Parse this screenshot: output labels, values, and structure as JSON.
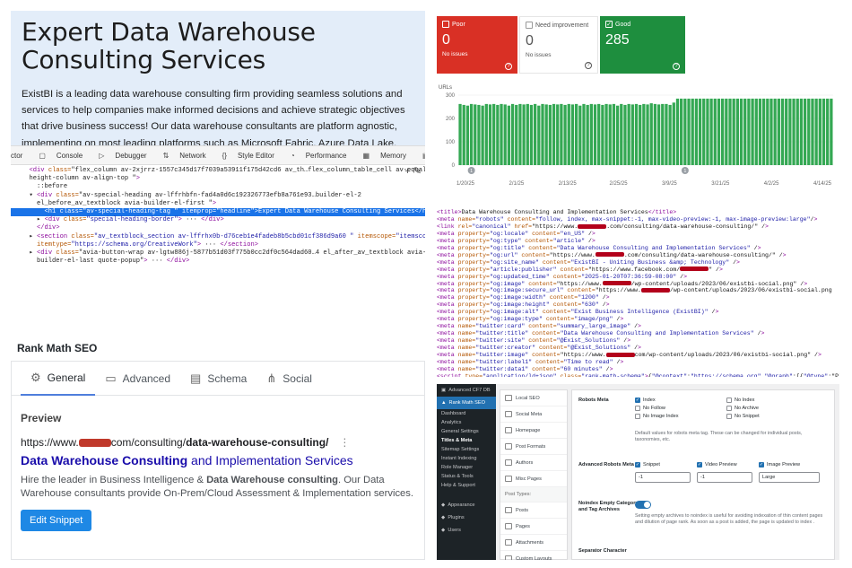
{
  "website": {
    "heading": "Expert Data Warehouse Consulting Services",
    "paragraph": "ExistBI is a leading data warehouse consulting firm providing seamless solutions and services to help companies make informed decisions and achieve strategic objectives that drive business success! Our data warehouse consultants are platform agnostic, implementing on most leading platforms such as Microsoft Fabric, Azure Data Lake, Azure SQL Data Warehouse, Azure Synapse,"
  },
  "devtools": {
    "tabs": [
      "ctor",
      "Console",
      "Debugger",
      "Network",
      "Style Editor",
      "Performance",
      "Memory",
      "Storage",
      "Accessi"
    ],
    "code_lines": [
      {
        "text": "  <div class=\"flex_column av-2xjrrz-1557c345d17f7039a53911f175d42cd6 av_th…flex_column_table_cell av-equal-",
        "sel": false
      },
      {
        "text": "  height-column av-align-top \">",
        "sel": false
      },
      {
        "text": "    ::before",
        "sel": false
      },
      {
        "text": "  ▾ <div class=\"av-special-heading av-lffrhbfn-fad4a0d6c192326773efb8a761e93…builder-el-2",
        "sel": false
      },
      {
        "text": "    el_before_av_textblock avia-builder-el-first \">",
        "sel": false
      },
      {
        "text": "      <h1 class=\"av-special-heading-tag \" itemprop=\"headline\">Expert Data Warehouse Consulting Services</h1>",
        "sel": true
      },
      {
        "text": "    ▸ <div class=\"special-heading-border\"> ··· </div>",
        "sel": false
      },
      {
        "text": "    </div>",
        "sel": false
      },
      {
        "text": "  ▸ <section class=\"av_textblock_section av-lffrhx0b-d76ceb1e4fadeb8b5cbd01cf386d9a60 \" itemscope=\"itemscope\"",
        "sel": false
      },
      {
        "text": "    itemtype=\"https://schema.org/CreativeWork\"> ··· </section>",
        "sel": false
      },
      {
        "text": "  ▸ <div class=\"avia-button-wrap av-lgtw886j-5877b51d03f775b0cc2df0c564dad60…4 el_after_av_textblock avia-",
        "sel": false
      },
      {
        "text": "    builder-el-last quote-popup\"> ··· </div>",
        "sel": false
      }
    ]
  },
  "rankmath": {
    "title": "Rank Math SEO",
    "tabs": [
      "General",
      "Advanced",
      "Schema",
      "Social"
    ],
    "preview_label": "Preview",
    "url_prefix": "https://www.",
    "url_path": "com/consulting/",
    "url_slug": "data-warehouse-consulting/",
    "serp_title_bold": "Data Warehouse Consulting",
    "serp_title_rest": " and Implementation Services",
    "serp_desc_1": "Hire the leader in Business Intelligence & ",
    "serp_desc_bold": "Data Warehouse consulting",
    "serp_desc_2": ". Our Data Warehouse consultants provide On-Prem/Cloud Assessment & Implementation services.",
    "edit_button": "Edit Snippet"
  },
  "console": {
    "cards": [
      {
        "label": "Poor",
        "value": "0",
        "sub": "No issues"
      },
      {
        "label": "Need improvement",
        "value": "0",
        "sub": "No issues"
      },
      {
        "label": "Good",
        "value": "285",
        "sub": ""
      }
    ],
    "urls_label": "URLs",
    "colors": {
      "poor": "#d93025",
      "good": "#1e8e3e",
      "bar": "#34a853"
    }
  },
  "chart_data": {
    "type": "bar",
    "ylabel": "URLs",
    "ylim": [
      0,
      300
    ],
    "yticks": [
      0,
      100,
      200,
      300
    ],
    "xticks": [
      "1/20/25",
      "2/1/25",
      "2/13/25",
      "2/25/25",
      "3/9/25",
      "3/21/25",
      "4/2/25",
      "4/14/25"
    ],
    "annotations": [
      {
        "index": 3,
        "label": "1"
      },
      {
        "index": 60,
        "label": "1"
      }
    ],
    "values": [
      262,
      258,
      255,
      262,
      260,
      258,
      255,
      262,
      260,
      262,
      258,
      262,
      260,
      255,
      262,
      258,
      262,
      260,
      262,
      258,
      262,
      255,
      262,
      260,
      258,
      262,
      260,
      262,
      258,
      262,
      260,
      262,
      255,
      262,
      258,
      262,
      260,
      262,
      258,
      262,
      260,
      262,
      255,
      262,
      258,
      262,
      260,
      262,
      258,
      262,
      260,
      265,
      262,
      260,
      262,
      262,
      258,
      268,
      285,
      285,
      285,
      285,
      285,
      285,
      285,
      285,
      285,
      285,
      285,
      285,
      285,
      285,
      285,
      285,
      285,
      285,
      285,
      285,
      285,
      285,
      285,
      285,
      285,
      285,
      285,
      285,
      285,
      285,
      285,
      285,
      285,
      285,
      285,
      285,
      285,
      285,
      285,
      285,
      285,
      285
    ]
  },
  "meta_source": [
    "<title>Data Warehouse Consulting and Implementation Services</title>",
    "<meta name=\"robots\" content=\"follow, index, max-snippet:-1, max-video-preview:-1, max-image-preview:large\"/>",
    "<link rel=\"canonical\" href=\"https://www.[R].com/consulting/data-warehouse-consulting/\" />",
    "<meta property=\"og:locale\" content=\"en_US\" />",
    "<meta property=\"og:type\" content=\"article\" />",
    "<meta property=\"og:title\" content=\"Data Warehouse Consulting and Implementation Services\" />",
    "<meta property=\"og:url\" content=\"https://www.[R].com/consulting/data-warehouse-consulting/\" />",
    "<meta property=\"og:site_name\" content=\"ExistBI - Uniting Business &amp; Technology\" />",
    "<meta property=\"article:publisher\" content=\"https://www.facebook.com/[R]\" />",
    "<meta property=\"og:updated_time\" content=\"2025-01-20T07:36:59-08:00\" />",
    "<meta property=\"og:image\" content=\"https://www.[R]/wp-content/uploads/2023/06/existbi-social.png\" />",
    "<meta property=\"og:image:secure_url\" content=\"https://www.[R]/wp-content/uploads/2023/06/existbi-social.png",
    "<meta property=\"og:image:width\" content=\"1200\" />",
    "<meta property=\"og:image:height\" content=\"630\" />",
    "<meta property=\"og:image:alt\" content=\"Exist Business Intelligence (ExistBI)\" />",
    "<meta property=\"og:image:type\" content=\"image/png\" />",
    "<meta name=\"twitter:card\" content=\"summary_large_image\" />",
    "<meta name=\"twitter:title\" content=\"Data Warehouse Consulting and Implementation Services\" />",
    "<meta name=\"twitter:site\" content=\"@Exist_Solutions\" />",
    "<meta name=\"twitter:creator\" content=\"@Exist_Solutions\" />",
    "<meta name=\"twitter:image\" content=\"https://www.[R]com/wp-content/uploads/2023/06/existbi-social.png\" />",
    "<meta name=\"twitter:label1\" content=\"Time to read\" />",
    "<meta name=\"twitter:data1\" content=\"60 minutes\" />",
    "<script type=\"application/ld+json\" class=\"rank-math-schema\">{\"@context\":\"https://schema.org\",\"@graph\":[{\"@type\":\"Pl"
  ],
  "wp": {
    "sidebar_top": [
      "Advanced CF7 DB"
    ],
    "sidebar_current": "Rank Math SEO",
    "sidebar_subs": [
      "Dashboard",
      "Analytics",
      "General Settings",
      "Titles & Meta",
      "Sitemap Settings",
      "Instant Indexing",
      "Role Manager",
      "Status & Tools",
      "Help & Support"
    ],
    "sidebar_bottom": [
      "Appearance",
      "Plugins",
      "Users"
    ],
    "nav_items": [
      "Local SEO",
      "Social Meta",
      "Homepage",
      "Post Formats",
      "Authors",
      "Misc Pages"
    ],
    "nav_header": "Post Types:",
    "nav_post_types": [
      "Posts",
      "Pages",
      "Attachments",
      "Custom Layouts"
    ],
    "robots_label": "Robots Meta",
    "robots_left": [
      {
        "label": "Index",
        "on": true
      },
      {
        "label": "No Follow",
        "on": false
      },
      {
        "label": "No Image Index",
        "on": false
      }
    ],
    "robots_right": [
      {
        "label": "No Index",
        "on": false
      },
      {
        "label": "No Archive",
        "on": false
      },
      {
        "label": "No Snippet",
        "on": false
      }
    ],
    "robots_help": "Default values for robots meta tag. These can be changed for individual posts, taxonomies, etc.",
    "adv_label": "Advanced Robots Meta",
    "adv_opts": [
      {
        "label": "Snippet",
        "value": "-1"
      },
      {
        "label": "Video Preview",
        "value": "-1"
      },
      {
        "label": "Image Preview",
        "value": "Large"
      }
    ],
    "noindex_label": "Noindex Empty Category and Tag Archives",
    "noindex_help": "Setting empty archives to  noindex  is useful for avoiding indexation of thin content pages and dilution of page rank. As soon as a post is added, the page is updated to  index .",
    "separator_label": "Separator Character"
  }
}
